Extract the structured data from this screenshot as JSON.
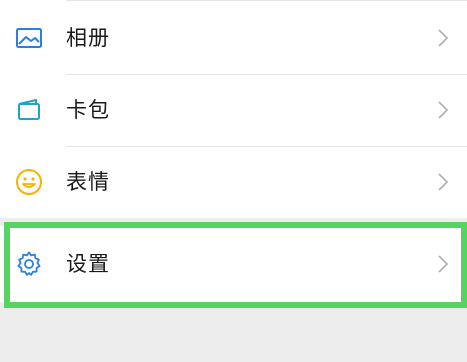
{
  "menu": {
    "items": [
      {
        "label": "相册",
        "icon": "album-icon"
      },
      {
        "label": "卡包",
        "icon": "card-wallet-icon"
      },
      {
        "label": "表情",
        "icon": "sticker-smile-icon"
      }
    ],
    "settings": {
      "label": "设置",
      "icon": "gear-icon"
    }
  },
  "colors": {
    "icon_blue": "#2a7fe0",
    "icon_teal": "#23a1c8",
    "icon_yellow": "#f5b400",
    "highlight_green": "#55d462",
    "chevron": "#b2b2b2"
  }
}
